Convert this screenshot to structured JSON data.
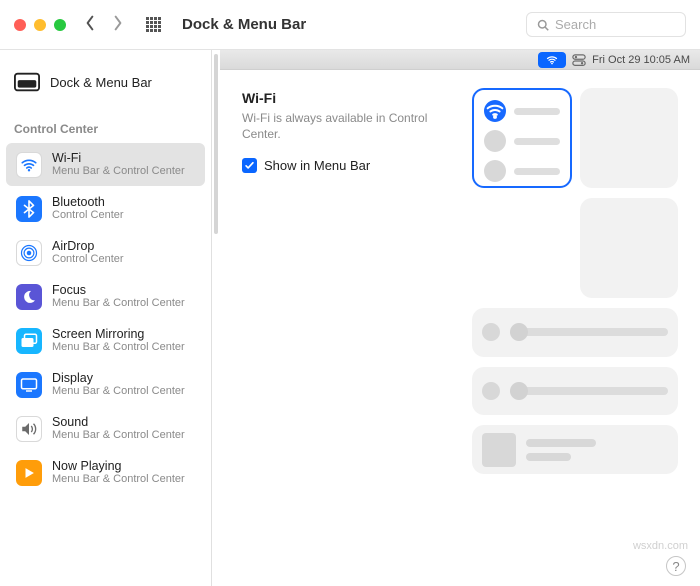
{
  "window": {
    "title": "Dock & Menu Bar"
  },
  "search": {
    "placeholder": "Search"
  },
  "menubar_time": "Fri Oct 29  10:05 AM",
  "sidebar": {
    "main_label": "Dock & Menu Bar",
    "section_heading": "Control Center",
    "items": [
      {
        "name": "Wi-Fi",
        "sub": "Menu Bar & Control Center"
      },
      {
        "name": "Bluetooth",
        "sub": "Control Center"
      },
      {
        "name": "AirDrop",
        "sub": "Control Center"
      },
      {
        "name": "Focus",
        "sub": "Menu Bar & Control Center"
      },
      {
        "name": "Screen Mirroring",
        "sub": "Menu Bar & Control Center"
      },
      {
        "name": "Display",
        "sub": "Menu Bar & Control Center"
      },
      {
        "name": "Sound",
        "sub": "Menu Bar & Control Center"
      },
      {
        "name": "Now Playing",
        "sub": "Menu Bar & Control Center"
      }
    ]
  },
  "detail": {
    "title": "Wi-Fi",
    "description": "Wi-Fi is always available in Control Center.",
    "checkbox_label": "Show in Menu Bar",
    "checkbox_checked": true
  },
  "help": "?",
  "watermark": "wsxdn.com"
}
